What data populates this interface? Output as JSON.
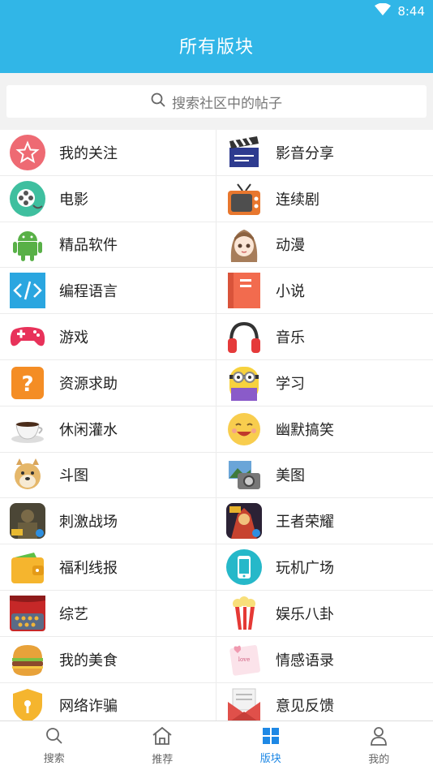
{
  "status": {
    "time": "8:44",
    "wifi_icon": "wifi-icon"
  },
  "header": {
    "title": "所有版块"
  },
  "search": {
    "placeholder": "搜索社区中的帖子",
    "icon": "search-icon"
  },
  "boards": [
    {
      "label": "我的关注",
      "icon": "star-icon"
    },
    {
      "label": "影音分享",
      "icon": "clapperboard-icon"
    },
    {
      "label": "电影",
      "icon": "film-reel-icon"
    },
    {
      "label": "连续剧",
      "icon": "tv-icon"
    },
    {
      "label": "精品软件",
      "icon": "android-icon"
    },
    {
      "label": "动漫",
      "icon": "anime-girl-icon"
    },
    {
      "label": "编程语言",
      "icon": "code-icon"
    },
    {
      "label": "小说",
      "icon": "book-icon"
    },
    {
      "label": "游戏",
      "icon": "gamepad-icon"
    },
    {
      "label": "音乐",
      "icon": "headphones-icon"
    },
    {
      "label": "资源求助",
      "icon": "question-icon"
    },
    {
      "label": "学习",
      "icon": "minion-icon"
    },
    {
      "label": "休闲灌水",
      "icon": "coffee-cup-icon"
    },
    {
      "label": "幽默搞笑",
      "icon": "laughing-face-icon"
    },
    {
      "label": "斗图",
      "icon": "doge-icon"
    },
    {
      "label": "美图",
      "icon": "photos-camera-icon"
    },
    {
      "label": "刺激战场",
      "icon": "pubg-icon"
    },
    {
      "label": "王者荣耀",
      "icon": "honor-of-kings-icon"
    },
    {
      "label": "福利线报",
      "icon": "wallet-icon"
    },
    {
      "label": "玩机广场",
      "icon": "phone-icon"
    },
    {
      "label": "综艺",
      "icon": "stage-icon"
    },
    {
      "label": "娱乐八卦",
      "icon": "popcorn-icon"
    },
    {
      "label": "我的美食",
      "icon": "burger-icon"
    },
    {
      "label": "情感语录",
      "icon": "love-note-icon"
    },
    {
      "label": "网络诈骗",
      "icon": "shield-icon"
    },
    {
      "label": "意见反馈",
      "icon": "envelope-icon"
    }
  ],
  "tabs": [
    {
      "label": "搜索",
      "icon": "search-icon",
      "active": false
    },
    {
      "label": "推荐",
      "icon": "home-icon",
      "active": false
    },
    {
      "label": "版块",
      "icon": "grid-icon",
      "active": true
    },
    {
      "label": "我的",
      "icon": "user-icon",
      "active": false
    }
  ],
  "colors": {
    "header": "#31b6e7",
    "active_tab": "#1e88e5"
  }
}
